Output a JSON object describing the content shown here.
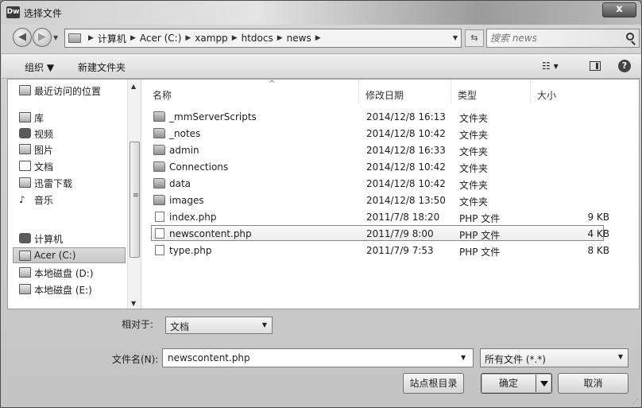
{
  "window": {
    "title": "选择文件",
    "app_icon": "Dw",
    "close_label": "x"
  },
  "address": {
    "crumbs": [
      "计算机",
      "Acer (C:)",
      "xampp",
      "htdocs",
      "news"
    ],
    "search_placeholder": "搜索 news"
  },
  "toolbar": {
    "organize": "组织 ▼",
    "new_folder": "新建文件夹",
    "view": "☷ ▾"
  },
  "nav": {
    "items": [
      {
        "label": "最近访问的位置",
        "icon": "recent-places-icon"
      },
      {
        "label": "库",
        "icon": "library-icon"
      },
      {
        "label": "视频",
        "icon": "video-icon"
      },
      {
        "label": "图片",
        "icon": "pictures-icon"
      },
      {
        "label": "文档",
        "icon": "documents-icon"
      },
      {
        "label": "迅雷下载",
        "icon": "download-icon"
      },
      {
        "label": "音乐",
        "icon": "music-icon"
      },
      {
        "label": "计算机",
        "icon": "computer-icon"
      },
      {
        "label": "Acer (C:)",
        "icon": "drive-icon"
      },
      {
        "label": "本地磁盘 (D:)",
        "icon": "drive-icon"
      },
      {
        "label": "本地磁盘 (E:)",
        "icon": "drive-icon"
      }
    ],
    "selected": "Acer (C:)"
  },
  "columns": {
    "name": "名称",
    "date": "修改日期",
    "type": "类型",
    "size": "大小"
  },
  "files": [
    {
      "name": "_mmServerScripts",
      "date": "2014/12/8 16:13",
      "type": "文件夹",
      "size": "",
      "kind": "folder"
    },
    {
      "name": "_notes",
      "date": "2014/12/8 10:42",
      "type": "文件夹",
      "size": "",
      "kind": "folder"
    },
    {
      "name": "admin",
      "date": "2014/12/8 16:33",
      "type": "文件夹",
      "size": "",
      "kind": "folder"
    },
    {
      "name": "Connections",
      "date": "2014/12/8 10:42",
      "type": "文件夹",
      "size": "",
      "kind": "folder"
    },
    {
      "name": "data",
      "date": "2014/12/8 10:42",
      "type": "文件夹",
      "size": "",
      "kind": "folder"
    },
    {
      "name": "images",
      "date": "2014/12/8 13:50",
      "type": "文件夹",
      "size": "",
      "kind": "folder"
    },
    {
      "name": "index.php",
      "date": "2011/7/8 18:20",
      "type": "PHP 文件",
      "size": "9 KB",
      "kind": "file"
    },
    {
      "name": "newscontent.php",
      "date": "2011/7/9 8:00",
      "type": "PHP 文件",
      "size": "4 KB",
      "kind": "file"
    },
    {
      "name": "type.php",
      "date": "2011/7/9 7:53",
      "type": "PHP 文件",
      "size": "8 KB",
      "kind": "file"
    }
  ],
  "selected_file": "newscontent.php",
  "bottom": {
    "relative_label": "相对于:",
    "relative_value": "文档",
    "filename_label": "文件名(N):",
    "filename_value": "newscontent.php",
    "filetype_value": "所有文件 (*.*)",
    "siteroot_button": "站点根目录",
    "ok_button": "确定",
    "cancel_button": "取消"
  }
}
